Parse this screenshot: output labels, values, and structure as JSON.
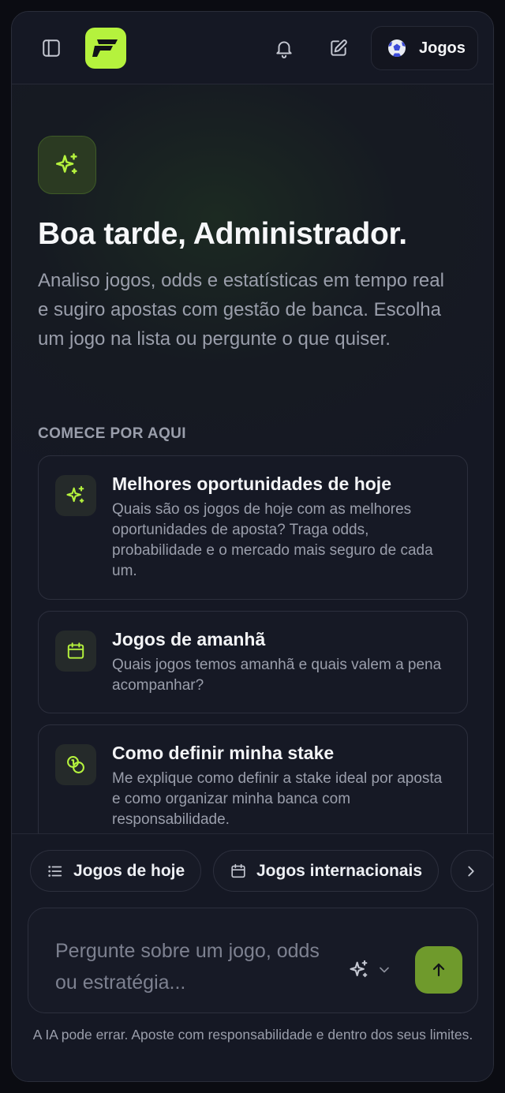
{
  "header": {
    "sidebar_icon": "sidebar-panel-icon",
    "logo_icon": "brand-f-logo",
    "notification_icon": "bell-icon",
    "new_chat_icon": "edit-square-icon",
    "games_button": {
      "icon": "soccer-ball-icon",
      "label": "Jogos"
    }
  },
  "hero": {
    "icon": "sparkles-icon",
    "title": "Boa tarde, Administrador.",
    "subtitle": "Analiso jogos, odds e estatísticas em tempo real e sugiro apostas com gestão de banca. Escolha um jogo na lista ou pergunte o que quiser."
  },
  "suggestions": {
    "section_label": "COMECE POR AQUI",
    "cards": [
      {
        "icon": "sparkles-icon",
        "title": "Melhores oportunidades de hoje",
        "description": "Quais são os jogos de hoje com as melhores oportunidades de aposta? Traga odds, probabilidade e o mercado mais seguro de cada um."
      },
      {
        "icon": "calendar-icon",
        "title": "Jogos de amanhã",
        "description": "Quais jogos temos amanhã e quais valem a pena acompanhar?"
      },
      {
        "icon": "coins-icon",
        "title": "Como definir minha stake",
        "description": "Me explique como definir a stake ideal por aposta e como organizar minha banca com responsabilidade."
      }
    ]
  },
  "quick_chips": [
    {
      "icon": "list-icon",
      "label": "Jogos de hoje"
    },
    {
      "icon": "calendar-icon",
      "label": "Jogos internacionais"
    },
    {
      "icon": "chevron-right-icon",
      "label": ""
    }
  ],
  "composer": {
    "placeholder": "Pergunte sobre um jogo, odds ou estratégia...",
    "model_icon": "sparkles-icon",
    "send_icon": "arrow-up-icon"
  },
  "footer": {
    "disclaimer": "A IA pode errar. Aposte com responsabilidade e dentro dos seus limites."
  },
  "colors": {
    "accent": "#b5f23d",
    "send_button": "#6f9a2c",
    "background": "#151824",
    "muted_text": "#9a9eab"
  }
}
